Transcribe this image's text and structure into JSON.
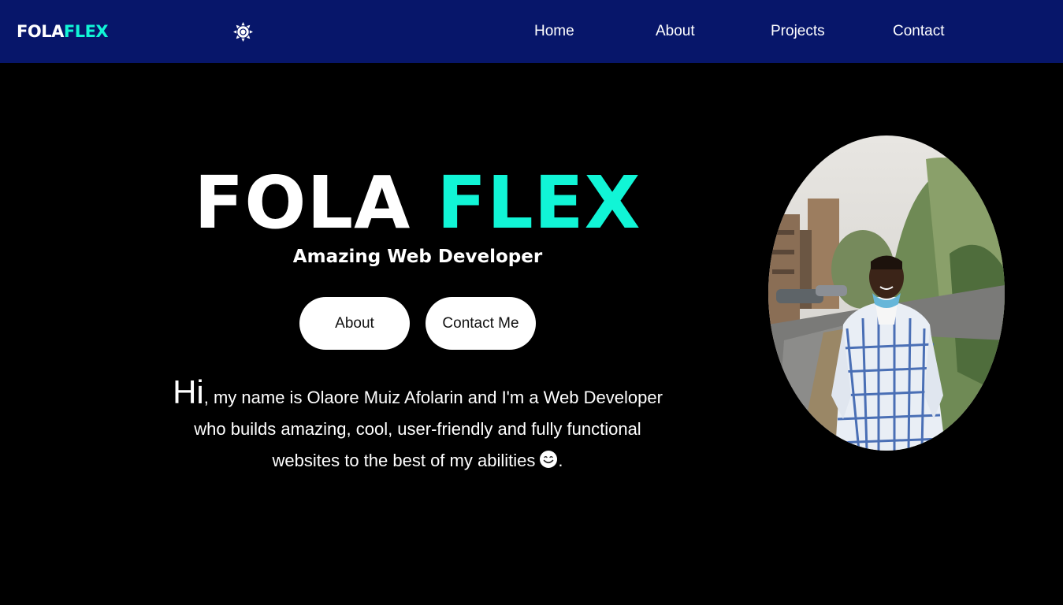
{
  "nav": {
    "logo_main": "FOLA",
    "logo_accent": "FLEX",
    "theme_icon": "sun-icon",
    "links": [
      {
        "label": "Home"
      },
      {
        "label": "About"
      },
      {
        "label": "Projects"
      },
      {
        "label": "Contact"
      }
    ]
  },
  "hero": {
    "title_main": "FOLA",
    "title_accent": "FLEX",
    "subtitle": "Amazing Web Developer",
    "buttons": {
      "about": "About",
      "contact": "Contact Me"
    },
    "intro": {
      "hi": "Hi",
      "line1": ", my name is Olaore Muiz Afolarin and I'm a Web Developer",
      "line2": "who builds amazing, cool, user-friendly and fully functional",
      "line3": "websites to the best of my abilities",
      "end": "."
    },
    "emoji_icon": "smiling-face-icon",
    "portrait": "profile-photo"
  },
  "colors": {
    "nav_bg": "#07166a",
    "accent": "#11f5d6",
    "page_bg": "#000000"
  }
}
